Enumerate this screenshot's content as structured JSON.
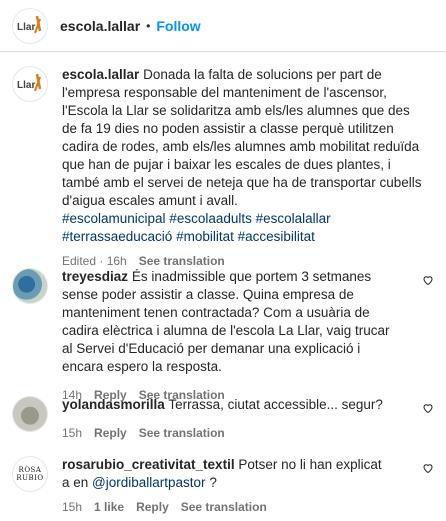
{
  "header": {
    "username": "escola.lallar",
    "separator": "•",
    "follow_label": "Follow",
    "logo_text": "Llar"
  },
  "caption": {
    "username": "escola.lallar",
    "text": "Donada la falta de solucions per part de l'empresa responsable del manteniment de l'ascensor, l'Escola la Llar se solidaritza amb els/les alumnes que des de fa 19 dies no poden assistir a classe perquè utilitzen cadira de rodes, amb els/les alumnes amb mobilitat reduïda que han de pujar i baixar les escales de dues plantes, i també amb el servei de neteja que ha de transportar cubells d'aigua escales amunt i avall.",
    "hashtags": "#escolamunicipal #escolaadults #escolalallar #terrassaeducació #mobilitat #accesibilitat",
    "edited": "Edited · 16h",
    "see_translation": "See translation"
  },
  "comments": [
    {
      "username": "treyesdiaz",
      "text": "És inadmissible que portem 3 setmanes sense poder assistir a classe. Quina empresa de manteniment tenen contractada? Com a usuària de cadira elèctrica i alumna de l'escola La Llar, vaig trucar al Servei d'Educació per demanar una explicació i encara espero la resposta.",
      "time": "14h",
      "reply": "Reply",
      "see_translation": "See translation"
    },
    {
      "username": "yolandasmorilla",
      "text": "Terrassa, ciutat accessible... segur?",
      "time": "15h",
      "reply": "Reply",
      "see_translation": "See translation"
    },
    {
      "username": "rosarubio_creativitat_textil",
      "text": "Potser no li han explicat a en",
      "mention": "@jordiballartpastor",
      "text_after": " ?",
      "time": "15h",
      "likes": "1 like",
      "reply": "Reply",
      "see_translation": "See translation",
      "avatar_text_1": "ROSA",
      "avatar_text_2": "RUBIO"
    }
  ],
  "colors": {
    "link": "#00376b",
    "follow": "#0095f6",
    "muted": "#737373",
    "brand_orange": "#e07b1a"
  }
}
